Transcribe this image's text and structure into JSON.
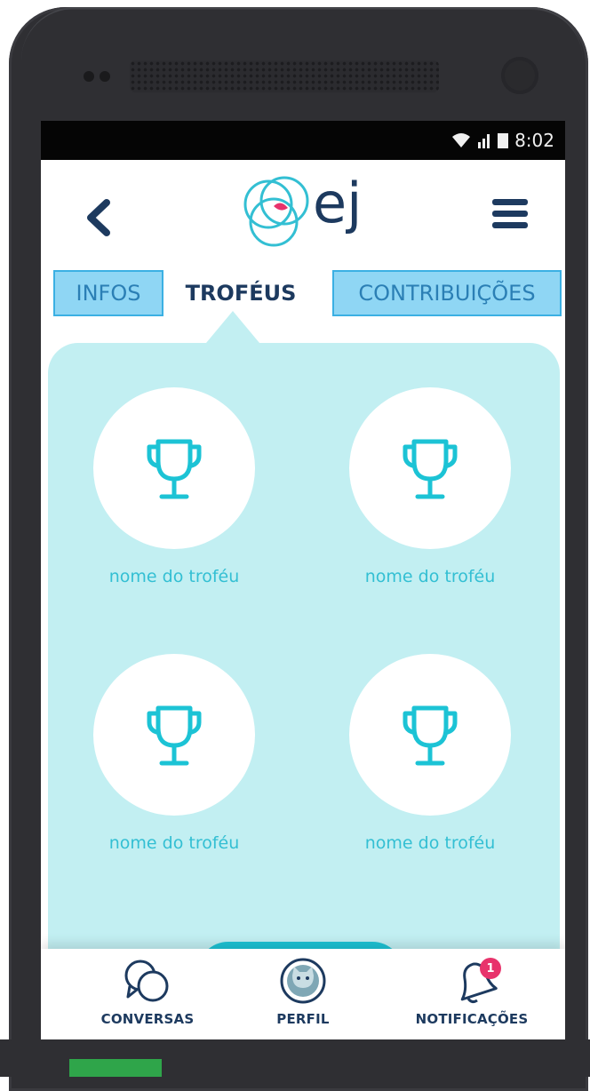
{
  "status_bar": {
    "time": "8:02"
  },
  "header": {
    "back_icon": "chevron-left-icon",
    "logo_text": "ej",
    "menu_icon": "hamburger-menu-icon"
  },
  "tabs": [
    {
      "label": "INFOS",
      "active": false
    },
    {
      "label": "TROFÉUS",
      "active": true
    },
    {
      "label": "CONTRIBUIÇÕES",
      "active": false
    }
  ],
  "trophies": [
    {
      "label": "nome do troféu",
      "icon": "trophy-icon"
    },
    {
      "label": "nome do troféu",
      "icon": "trophy-icon"
    },
    {
      "label": "nome do troféu",
      "icon": "trophy-icon"
    },
    {
      "label": "nome do troféu",
      "icon": "trophy-icon"
    }
  ],
  "bottom_nav": [
    {
      "label": "CONVERSAS",
      "icon": "conversations-icon"
    },
    {
      "label": "PERFIL",
      "icon": "profile-cat-icon"
    },
    {
      "label": "NOTIFICAÇÕES",
      "icon": "bell-icon",
      "badge": "1"
    }
  ],
  "colors": {
    "accent": "#1cc3d5",
    "panel": "#c2eff2",
    "navy": "#1d3a5f",
    "badge": "#e8336c",
    "tab_inactive": "#8fd6f4"
  }
}
